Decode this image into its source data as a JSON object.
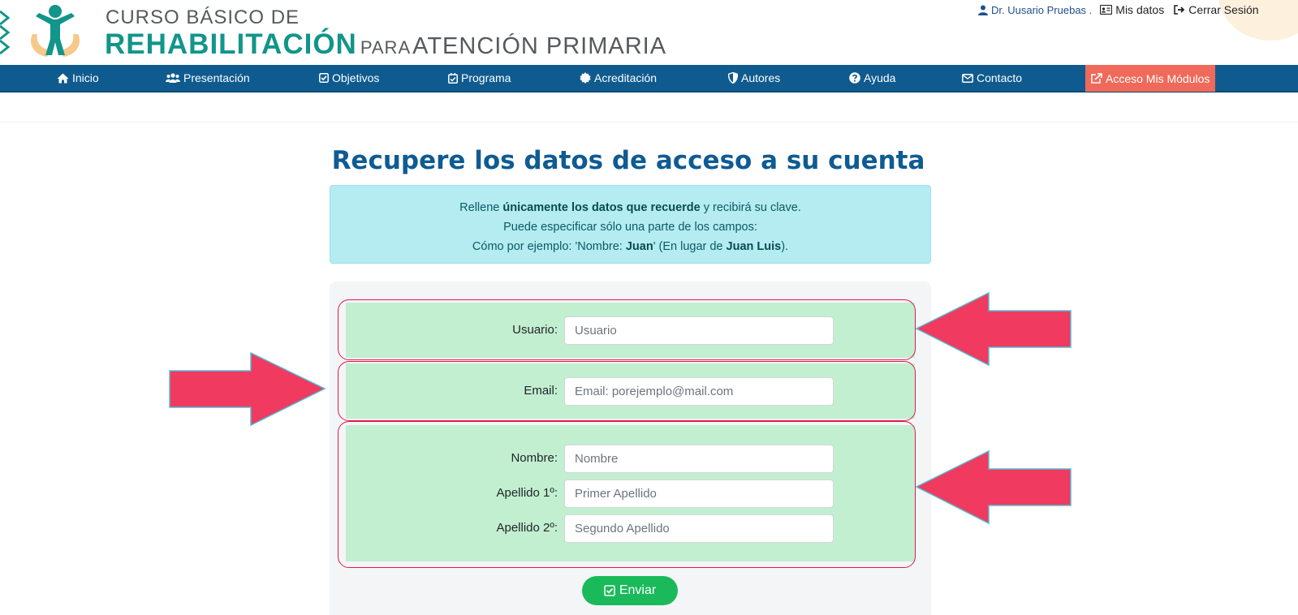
{
  "header": {
    "title_line1": "CURSO BÁSICO DE",
    "title_main": "REHABILITACIÓN",
    "title_para": "PARA",
    "title_rest": "ATENCIÓN PRIMARIA",
    "user_name": "Dr. Uusario Pruebas .",
    "my_data": "Mis datos",
    "logout": "Cerrar Sesión"
  },
  "nav": {
    "items": [
      {
        "label": "Inicio",
        "icon": "home-icon"
      },
      {
        "label": "Presentación",
        "icon": "users-icon"
      },
      {
        "label": "Objetivos",
        "icon": "check-square-icon"
      },
      {
        "label": "Programa",
        "icon": "calendar-check-icon"
      },
      {
        "label": "Acreditación",
        "icon": "certificate-icon"
      },
      {
        "label": "Autores",
        "icon": "shield-icon"
      },
      {
        "label": "Ayuda",
        "icon": "question-circle-icon"
      },
      {
        "label": "Contacto",
        "icon": "envelope-icon"
      },
      {
        "label": "Acceso Mis Módulos",
        "icon": "external-link-icon"
      }
    ]
  },
  "main": {
    "title": "Recupere los datos de acceso a su cuenta",
    "info": {
      "l1_pre": "Rellene ",
      "l1_bold": "únicamente los datos que recuerde",
      "l1_post": " y recibirá su clave.",
      "l2": "Puede especificar sólo una parte de los campos:",
      "l3_pre": "Cómo por ejemplo: 'Nombre: ",
      "l3_bold1": "Juan",
      "l3_mid": "' (En lugar de ",
      "l3_bold2": "Juan Luis",
      "l3_post": ")."
    }
  },
  "form": {
    "usuario_label": "Usuario:",
    "usuario_placeholder": "Usuario",
    "usuario_value": "",
    "email_label": "Email:",
    "email_placeholder": "Email: porejemplo@mail.com",
    "email_value": "",
    "nombre_label": "Nombre:",
    "nombre_placeholder": "Nombre",
    "nombre_value": "",
    "apellido1_label": "Apellido 1º:",
    "apellido1_placeholder": "Primer Apellido",
    "apellido1_value": "",
    "apellido2_label": "Apellido 2º:",
    "apellido2_placeholder": "Segundo Apellido",
    "apellido2_value": "",
    "submit_label": "Enviar"
  },
  "colors": {
    "nav_bg": "#0f5b8f",
    "accent": "#ef6a5a",
    "brand_teal": "#12958a",
    "title_blue": "#0f5b93",
    "info_bg": "#b4ecf2",
    "field_group_bg": "#c2efd0",
    "annotation": "#f03a5f",
    "submit": "#1aba5a"
  }
}
